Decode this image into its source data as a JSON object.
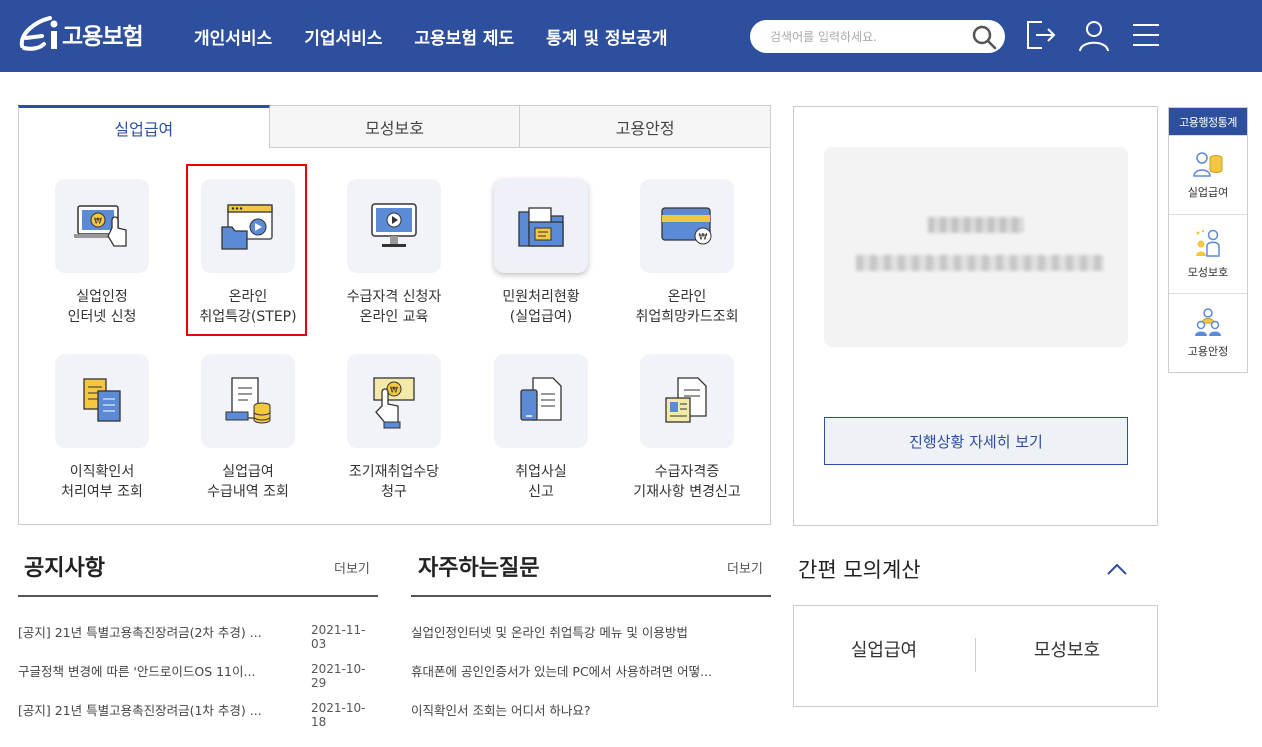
{
  "header": {
    "logo_text": "고용보험",
    "nav": [
      "개인서비스",
      "기업서비스",
      "고용보험 제도",
      "통계 및 정보공개"
    ],
    "search_placeholder": "검색어를 입력하세요.",
    "icons": [
      "search-icon",
      "logout-icon",
      "user-icon",
      "menu-icon"
    ],
    "brand_color": "#2e4f9e"
  },
  "tabs": [
    "실업급여",
    "모성보호",
    "고용안정"
  ],
  "active_tab": "실업급여",
  "services": [
    {
      "label": "실업인정\n인터넷 신청",
      "icon": "laptop-click-icon"
    },
    {
      "label": "온라인\n취업특강(STEP)",
      "icon": "video-lecture-icon",
      "highlighted": true
    },
    {
      "label": "수급자격 신청자\n온라인 교육",
      "icon": "monitor-play-icon"
    },
    {
      "label": "민원처리현황\n(실업급여)",
      "icon": "folder-document-icon",
      "selected": true
    },
    {
      "label": "온라인\n취업희망카드조회",
      "icon": "card-icon"
    },
    {
      "label": "이직확인서\n처리여부 조회",
      "icon": "documents-icon"
    },
    {
      "label": "실업급여\n수급내역 조회",
      "icon": "receipt-coins-icon"
    },
    {
      "label": "조기재취업수당\n청구",
      "icon": "hand-money-icon"
    },
    {
      "label": "취업사실\n신고",
      "icon": "phone-document-icon"
    },
    {
      "label": "수급자격증\n기재사항 변경신고",
      "icon": "certificate-edit-icon"
    }
  ],
  "progress": {
    "detail_button": "진행상황 자세히 보기"
  },
  "quick": {
    "title": "고용행정통계",
    "items": [
      "실업급여",
      "모성보호",
      "고용안정"
    ]
  },
  "notice": {
    "title": "공지사항",
    "more": "더보기",
    "rows": [
      {
        "text": "[공지] 21년 특별고용촉진장려금(2차 추경) ...",
        "date": "2021-11-03"
      },
      {
        "text": "구글정책 변경에 따른 '안드로이드OS 11이...",
        "date": "2021-10-29"
      },
      {
        "text": "[공지] 21년 특별고용촉진장려금(1차 추경) ...",
        "date": "2021-10-18"
      }
    ]
  },
  "faq": {
    "title": "자주하는질문",
    "more": "더보기",
    "rows": [
      "실업인정인터넷 및 온라인 취업특강 메뉴 및 이용방법",
      "휴대폰에 공인인증서가 있는데 PC에서 사용하려면 어떻...",
      "이직확인서 조회는 어디서 하나요?"
    ]
  },
  "calc": {
    "title": "간편 모의계산",
    "buttons": [
      "실업급여",
      "모성보호"
    ]
  }
}
